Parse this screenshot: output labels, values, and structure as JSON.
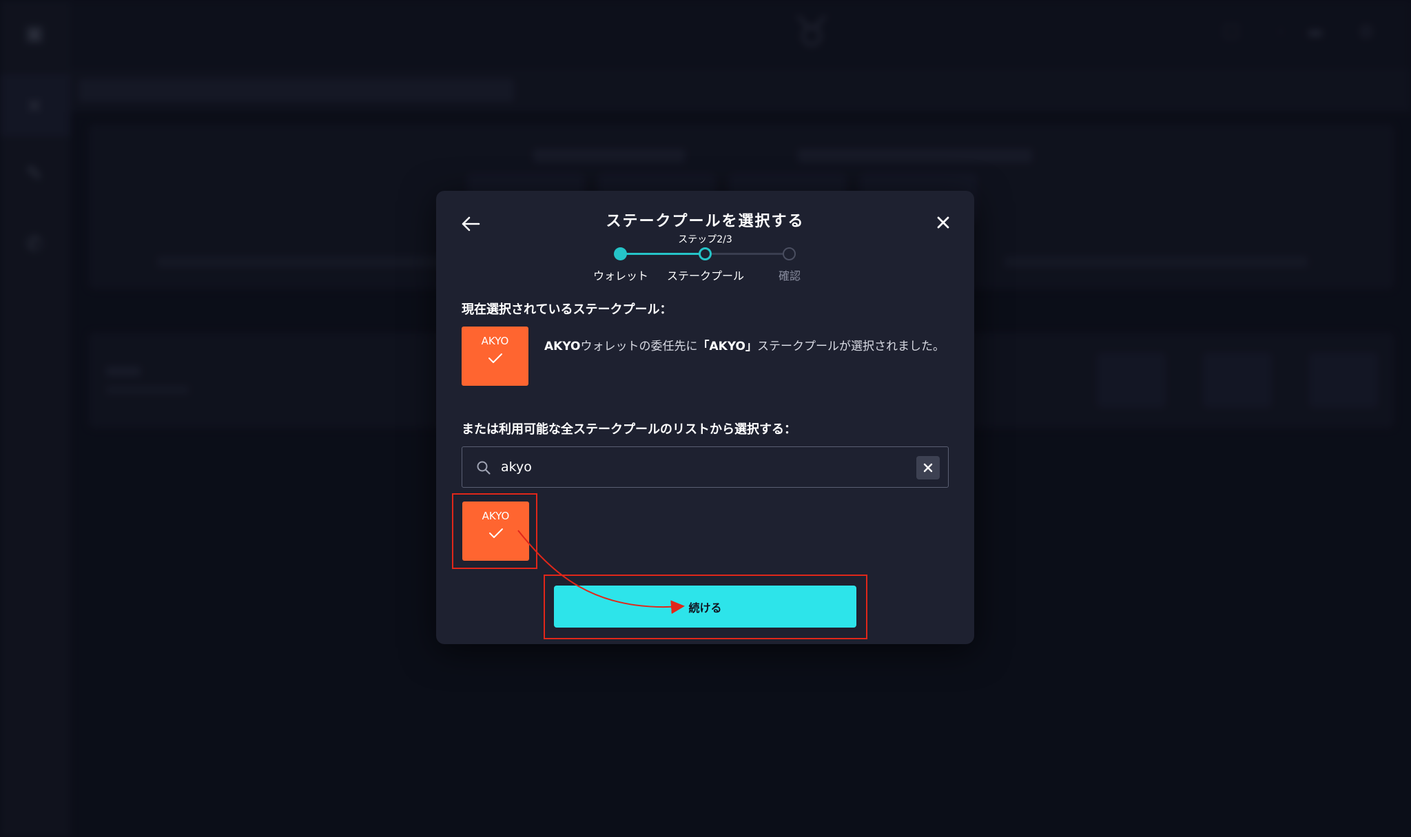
{
  "modal": {
    "title": "ステークプールを選択する",
    "step_label": "ステップ2/3",
    "steps": [
      {
        "label": "ウォレット",
        "state": "done"
      },
      {
        "label": "ステークプール",
        "state": "current"
      },
      {
        "label": "確認",
        "state": "pending"
      }
    ],
    "current_pool_heading": "現在選択されているステークプール：",
    "current_pool": {
      "ticker": "AKYO",
      "color": "#ff6530"
    },
    "selected_message": {
      "wallet": "AKYO",
      "part1": "ウォレットの委任先に",
      "pool_quoted": "「AKYO」",
      "part2": "ステークプールが選択されました。"
    },
    "list_heading": "または利用可能な全ステークプールのリストから選択する：",
    "search": {
      "value": "akyo",
      "icon": "search-icon"
    },
    "results": [
      {
        "ticker": "AKYO",
        "color": "#ff6530",
        "selected": true
      }
    ],
    "continue_label": "続ける"
  },
  "colors": {
    "accent": "#2de4ea",
    "step_active": "#25c4c8",
    "pool_tile": "#ff6530",
    "annotation": "#e0271a",
    "modal_bg": "#1e2130"
  },
  "icons": {
    "back": "arrow-left-icon",
    "close": "close-icon",
    "clear": "clear-icon",
    "check": "check-icon"
  }
}
